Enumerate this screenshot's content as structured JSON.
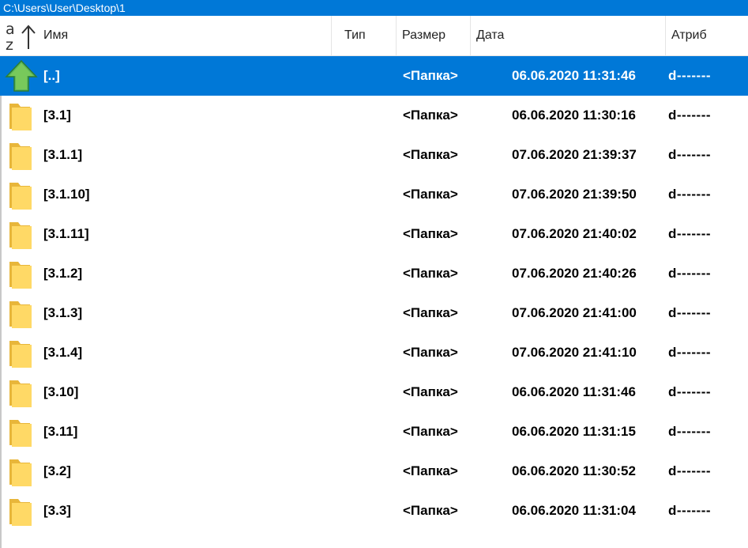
{
  "path": "C:\\Users\\User\\Desktop\\1",
  "columns": {
    "name": "Имя",
    "type": "Тип",
    "size": "Размер",
    "date": "Дата",
    "attr": "Атриб"
  },
  "sort_icon": {
    "letter_top": "a",
    "letter_bottom": "z",
    "icon": "sort-ascending-icon"
  },
  "colors": {
    "selection": "#0078d7",
    "folder": "#ffd966",
    "up_arrow": "#4caf50"
  },
  "rows": [
    {
      "icon": "up-arrow-icon",
      "name": "[..]",
      "size": "<Папка>",
      "date": "06.06.2020 11:31:46",
      "attr": "d-------",
      "selected": true
    },
    {
      "icon": "folder-icon",
      "name": "[3.1]",
      "size": "<Папка>",
      "date": "06.06.2020 11:30:16",
      "attr": "d-------"
    },
    {
      "icon": "folder-icon",
      "name": "[3.1.1]",
      "size": "<Папка>",
      "date": "07.06.2020 21:39:37",
      "attr": "d-------"
    },
    {
      "icon": "folder-icon",
      "name": "[3.1.10]",
      "size": "<Папка>",
      "date": "07.06.2020 21:39:50",
      "attr": "d-------"
    },
    {
      "icon": "folder-icon",
      "name": "[3.1.11]",
      "size": "<Папка>",
      "date": "07.06.2020 21:40:02",
      "attr": "d-------"
    },
    {
      "icon": "folder-icon",
      "name": "[3.1.2]",
      "size": "<Папка>",
      "date": "07.06.2020 21:40:26",
      "attr": "d-------"
    },
    {
      "icon": "folder-icon",
      "name": "[3.1.3]",
      "size": "<Папка>",
      "date": "07.06.2020 21:41:00",
      "attr": "d-------"
    },
    {
      "icon": "folder-icon",
      "name": "[3.1.4]",
      "size": "<Папка>",
      "date": "07.06.2020 21:41:10",
      "attr": "d-------"
    },
    {
      "icon": "folder-icon",
      "name": "[3.10]",
      "size": "<Папка>",
      "date": "06.06.2020 11:31:46",
      "attr": "d-------"
    },
    {
      "icon": "folder-icon",
      "name": "[3.11]",
      "size": "<Папка>",
      "date": "06.06.2020 11:31:15",
      "attr": "d-------"
    },
    {
      "icon": "folder-icon",
      "name": "[3.2]",
      "size": "<Папка>",
      "date": "06.06.2020 11:30:52",
      "attr": "d-------"
    },
    {
      "icon": "folder-icon",
      "name": "[3.3]",
      "size": "<Папка>",
      "date": "06.06.2020 11:31:04",
      "attr": "d-------"
    }
  ]
}
